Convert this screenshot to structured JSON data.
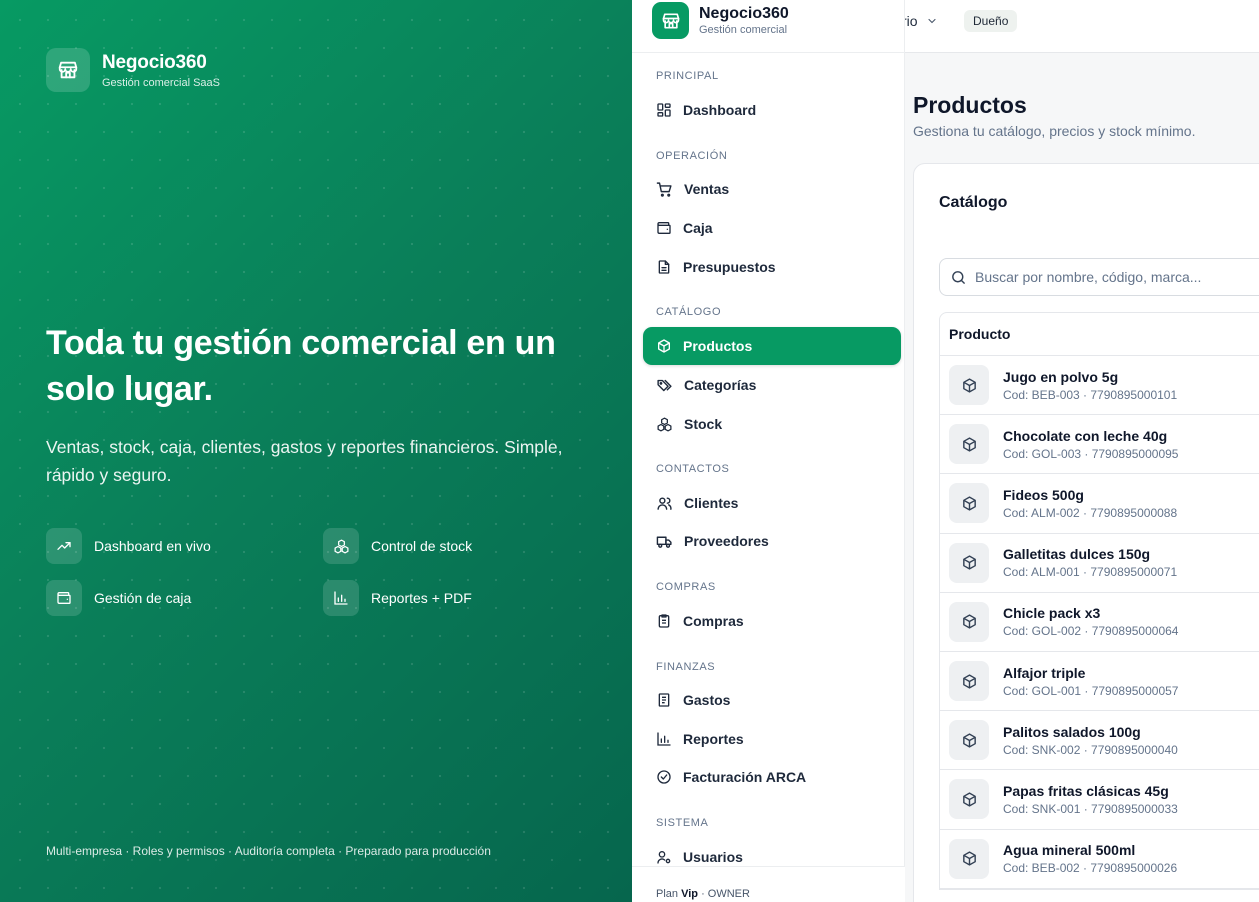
{
  "hero": {
    "brand_name": "Negocio360",
    "brand_subtitle": "Gestión comercial SaaS",
    "headline": "Toda tu gestión comercial en un solo lugar.",
    "description": "Ventas, stock, caja, clientes, gastos y reportes financieros. Simple, rápido y seguro.",
    "features": [
      {
        "label": "Dashboard en vivo",
        "icon": "trend-up-icon"
      },
      {
        "label": "Control de stock",
        "icon": "boxes-icon"
      },
      {
        "label": "Gestión de caja",
        "icon": "wallet-icon"
      },
      {
        "label": "Reportes + PDF",
        "icon": "bar-chart-icon"
      }
    ],
    "footer": "Multi-empresa · Roles y permisos · Auditoría completa · Preparado para producción"
  },
  "topbar": {
    "user_truncated": "rio",
    "role_badge": "Dueño"
  },
  "sidebar": {
    "brand_name": "Negocio360",
    "brand_subtitle": "Gestión comercial",
    "sections": {
      "principal": "PRINCIPAL",
      "operacion": "OPERACIÓN",
      "catalogo": "CATÁLOGO",
      "contactos": "CONTACTOS",
      "compras": "COMPRAS",
      "finanzas": "FINANZAS",
      "sistema": "SISTEMA"
    },
    "items": {
      "dashboard": "Dashboard",
      "ventas": "Ventas",
      "caja": "Caja",
      "presupuestos": "Presupuestos",
      "productos": "Productos",
      "categorias": "Categorías",
      "stock": "Stock",
      "clientes": "Clientes",
      "proveedores": "Proveedores",
      "compras": "Compras",
      "gastos": "Gastos",
      "reportes": "Reportes",
      "facturacion": "Facturación ARCA",
      "usuarios": "Usuarios"
    },
    "active_item": "Productos",
    "plan_prefix": "Plan",
    "plan_name": "Vip",
    "plan_suffix": "· OWNER"
  },
  "main": {
    "title": "Productos",
    "subtitle": "Gestiona tu catálogo, precios y stock mínimo.",
    "card_title": "Catálogo",
    "search_placeholder": "Buscar por nombre, código, marca...",
    "table_header": "Producto",
    "products": [
      {
        "name": "Jugo en polvo 5g",
        "code": "Cod: BEB-003 · 7790895000101"
      },
      {
        "name": "Chocolate con leche 40g",
        "code": "Cod: GOL-003 · 7790895000095"
      },
      {
        "name": "Fideos 500g",
        "code": "Cod: ALM-002 · 7790895000088"
      },
      {
        "name": "Galletitas dulces 150g",
        "code": "Cod: ALM-001 · 7790895000071"
      },
      {
        "name": "Chicle pack x3",
        "code": "Cod: GOL-002 · 7790895000064"
      },
      {
        "name": "Alfajor triple",
        "code": "Cod: GOL-001 · 7790895000057"
      },
      {
        "name": "Palitos salados 100g",
        "code": "Cod: SNK-002 · 7790895000040"
      },
      {
        "name": "Papas fritas clásicas 45g",
        "code": "Cod: SNK-001 · 7790895000033"
      },
      {
        "name": "Agua mineral 500ml",
        "code": "Cod: BEB-002 · 7790895000026"
      }
    ]
  },
  "colors": {
    "brand_green": "#079a63",
    "hero_gradient_start": "#079a63",
    "hero_gradient_end": "#06664d"
  }
}
